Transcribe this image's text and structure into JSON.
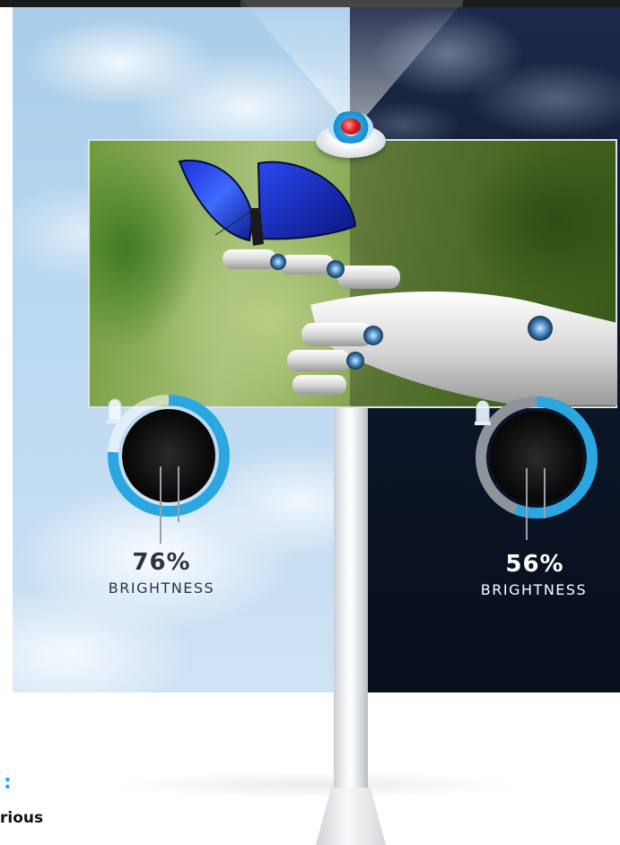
{
  "gauges": {
    "day": {
      "value_percent": 76,
      "value_text": "76%",
      "label": "BRIGHTNESS"
    },
    "night": {
      "value_percent": 56,
      "value_text": "56%",
      "label": "BRIGHTNESS"
    }
  },
  "footer": {
    "heading_fragment": ":",
    "text_fragment": "rious"
  },
  "colors": {
    "accent": "#2aa6e0",
    "day_sky": "#b9d8f1",
    "night_sky": "#0b1426",
    "gauge_track": "#8d949b"
  },
  "icons": [
    "projector-icon",
    "led-bulb-icon",
    "butterfly-icon",
    "robot-hand-icon"
  ]
}
